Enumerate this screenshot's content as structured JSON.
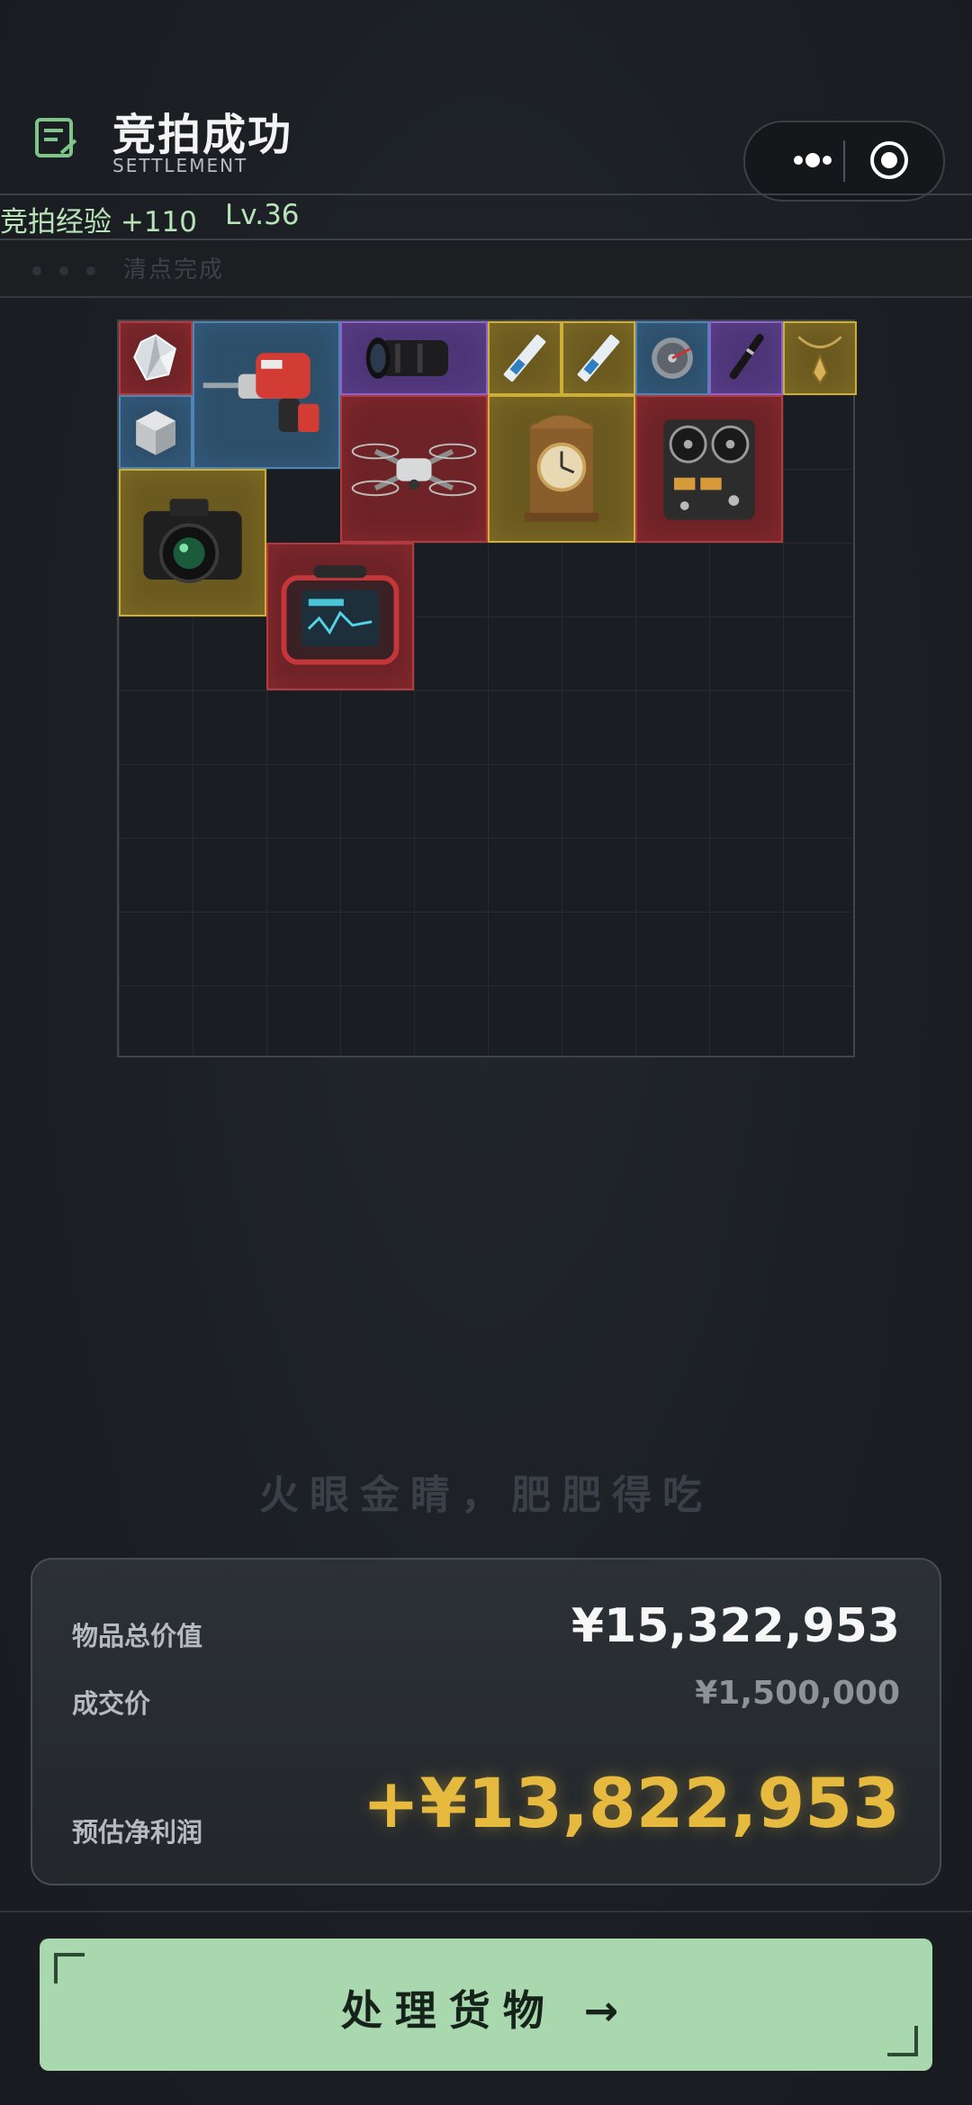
{
  "header": {
    "title": "竞拍成功",
    "subtitle": "SETTLEMENT",
    "exp": "竞拍经验 +110",
    "level": "Lv.36",
    "status": "清点完成"
  },
  "slogan": "火眼金睛，肥肥得吃",
  "summary": {
    "total_label": "物品总价值",
    "total_value": "¥15,322,953",
    "deal_label": "成交价",
    "deal_value": "¥1,500,000",
    "profit_label": "预估净利润",
    "profit_value": "+¥13,822,953"
  },
  "action": {
    "label": "处理货物 →"
  },
  "colors": {
    "accent_green": "#a9d8ae",
    "profit_gold": "#e6b93f",
    "rarity_red": "#b33a3e",
    "rarity_gold": "#cfae37",
    "rarity_purple": "#8c62cf",
    "rarity_blue": "#4f86b3"
  },
  "items": [
    {
      "name": "diamond",
      "rarity": "red",
      "icon": "diamond-icon"
    },
    {
      "name": "rotary-hammer",
      "rarity": "blue",
      "icon": "hammer-drill-icon"
    },
    {
      "name": "camera-lens",
      "rarity": "purple",
      "icon": "lens-icon"
    },
    {
      "name": "ssd-stick-1",
      "rarity": "gold",
      "icon": "ssd-icon"
    },
    {
      "name": "ssd-stick-2",
      "rarity": "gold",
      "icon": "ssd-icon"
    },
    {
      "name": "hard-disk",
      "rarity": "blue",
      "icon": "hard-disk-icon"
    },
    {
      "name": "fountain-pen",
      "rarity": "purple",
      "icon": "pen-icon"
    },
    {
      "name": "pendant-necklace",
      "rarity": "gold",
      "icon": "necklace-icon"
    },
    {
      "name": "metal-cube",
      "rarity": "blue",
      "icon": "cube-icon"
    },
    {
      "name": "drone",
      "rarity": "red",
      "icon": "drone-icon"
    },
    {
      "name": "antique-clock",
      "rarity": "gold",
      "icon": "clock-icon"
    },
    {
      "name": "reel-tape-recorder",
      "rarity": "red",
      "icon": "tape-recorder-icon"
    },
    {
      "name": "dslr-camera",
      "rarity": "gold",
      "icon": "camera-icon"
    },
    {
      "name": "field-monitor",
      "rarity": "red",
      "icon": "monitor-icon"
    }
  ]
}
